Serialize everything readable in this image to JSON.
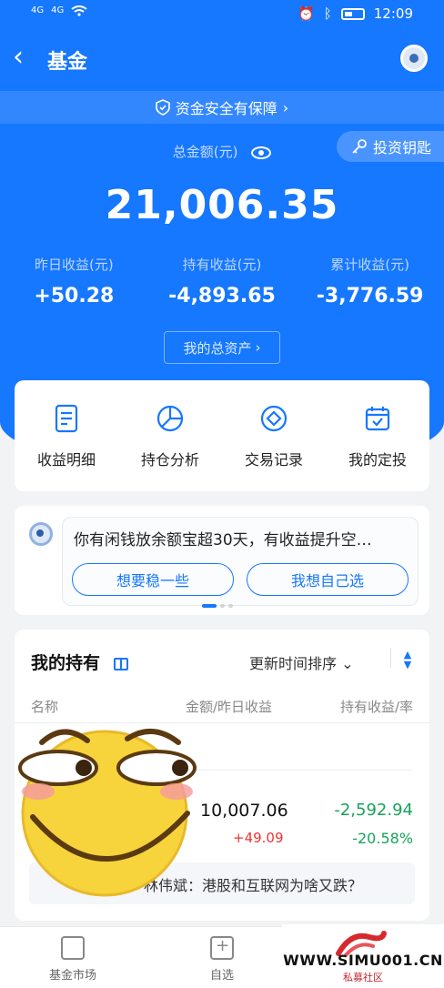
{
  "status_bar": {
    "time": "12:09",
    "network_1": "4G",
    "network_2": "4G"
  },
  "header": {
    "title": "基金",
    "back_icon": "chevron-left-icon",
    "assistant_icon": "robot-icon"
  },
  "safety_banner": {
    "text": "资金安全有保障",
    "icon": "shield-check-icon"
  },
  "investment_key": {
    "label": "投资钥匙",
    "icon": "key-icon"
  },
  "summary": {
    "total_label": "总金额(元)",
    "total_value": "21,006.35",
    "metrics": [
      {
        "label": "昨日收益(元)",
        "value": "+50.28"
      },
      {
        "label": "持有收益(元)",
        "value": "-4,893.65"
      },
      {
        "label": "累计收益(元)",
        "value": "-3,776.59"
      }
    ],
    "assets_button": "我的总资产"
  },
  "quick_actions": [
    {
      "label": "收益明细",
      "icon": "document-icon"
    },
    {
      "label": "持仓分析",
      "icon": "pie-chart-icon"
    },
    {
      "label": "交易记录",
      "icon": "diamond-icon"
    },
    {
      "label": "我的定投",
      "icon": "calendar-check-icon"
    }
  ],
  "notice": {
    "text": "你有闲钱放余额宝超30天，有收益提升空…",
    "options": [
      "想要稳一些",
      "我想自己选"
    ]
  },
  "holdings": {
    "title": "我的持有",
    "sort_label": "更新时间排序",
    "columns": {
      "name": "名称",
      "amount": "金额/昨日收益",
      "profit": "持有收益/率"
    },
    "rows": [
      {
        "amount": "10,007.06",
        "yesterday": "+49.09",
        "profit": "-2,592.94",
        "rate": "-20.58%"
      }
    ],
    "news": "林伟斌：港股和互联网为啥又跌？"
  },
  "tabbar": [
    {
      "label": "基金市场",
      "icon": "market-icon"
    },
    {
      "label": "自选",
      "icon": "add-favorite-icon"
    }
  ],
  "watermark": {
    "text": "WWW.SIMU001.CN",
    "sub": "私募社区"
  },
  "colors": {
    "brand_blue": "#1677ff",
    "gain_red": "#e33333",
    "loss_green": "#17a35a"
  }
}
